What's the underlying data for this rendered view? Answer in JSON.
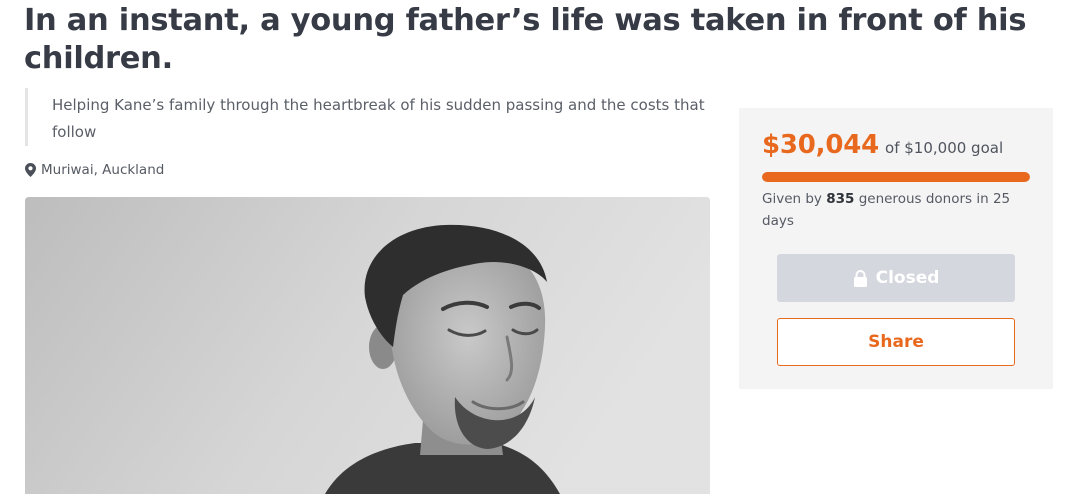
{
  "page": {
    "title": "In an instant, a young father’s life was taken in front of his children.",
    "subtitle": "Helping Kane’s family through the heartbreak of his sudden passing and the costs that follow",
    "location": "Muriwai, Auckland",
    "location_icon": "map-pin-icon",
    "photo_icon": "campaign-photo"
  },
  "donation": {
    "raised": "$30,044",
    "goal_text": "of $10,000 goal",
    "progress_fraction": 1.0,
    "donors_prefix": "Given by ",
    "donor_count": "835",
    "donors_suffix": " generous donors in 25 days",
    "closed_label": "Closed",
    "closed_icon": "lock-icon",
    "share_label": "Share"
  },
  "colors": {
    "accent": "#e8691e",
    "panel_bg": "#f4f4f5",
    "closed_button": "#d4d7dd",
    "title_text": "#363b46"
  }
}
